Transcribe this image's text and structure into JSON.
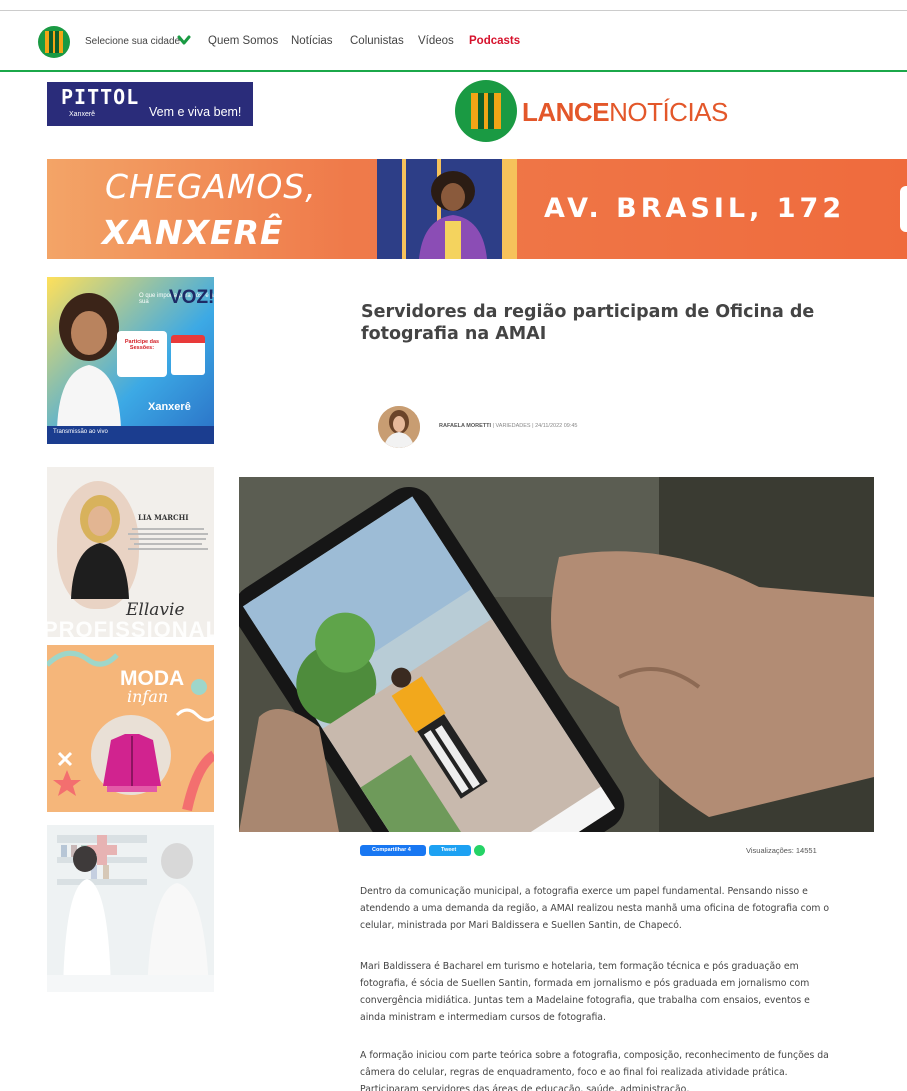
{
  "nav": {
    "city_select": "Selecione sua cidade",
    "links": [
      "Quem Somos",
      "Notícias",
      "Colunistas",
      "Vídeos",
      "Podcasts"
    ]
  },
  "header": {
    "pittol_brand": "PITTOL",
    "pittol_sub": "Xanxerê",
    "pittol_tagline": "Vem e viva bem!",
    "site_name_bold": "LANCE",
    "site_name_light": "NOTÍCIAS"
  },
  "banner": {
    "line1": "CHEGAMOS,",
    "line2": "XANXERÊ",
    "address": "AV. BRASIL, 172"
  },
  "sidebar_ads": {
    "ad1": {
      "question": "O que importa para nós, é a sua",
      "voz": "VOZ!",
      "participe": "Participe das Sessões:",
      "city": "Xanxerê",
      "transmission": "Transmissão ao vivo"
    },
    "ad2": {
      "name": "LIA MARCHI",
      "signature": "Ellavie",
      "watermark": "PROFISSIONAL"
    },
    "ad3": {
      "moda": "MODA",
      "infan": "infan"
    }
  },
  "article": {
    "title": "Servidores da região participam de Oficina de fotografia na AMAI",
    "author": "RAFAELA MORETTI",
    "byline_rest": " | VARIEDADES | 24/11/2022 09:45",
    "share_facebook": "Compartilhar",
    "share_tweet": "Tweet",
    "views": "Visualizações: 14551",
    "paragraphs": [
      "Dentro da comunicação municipal, a fotografia exerce um papel fundamental. Pensando nisso e atendendo a uma demanda da região, a AMAI realizou nesta manhã uma oficina de fotografia com o celular, ministrada por Mari Baldissera e Suellen Santin, de Chapecó.",
      "Mari Baldissera é Bacharel em turismo e hotelaria, tem formação técnica e pós graduação em fotografia, é sócia de Suellen Santin, formada em jornalismo e pós graduada em jornalismo com convergência midiática.  Juntas tem a Madelaine fotografia, que trabalha com ensaios, eventos e ainda ministram e intermediam cursos de fotografia.",
      "A formação iniciou com parte teórica sobre a fotografia, composição, reconhecimento de funções da câmera do celular, regras de enquadramento, foco e ao final foi realizada atividade prática. Participaram servidores das áreas de educação, saúde, administração,"
    ]
  },
  "colors": {
    "brand_green": "#1a9a43",
    "brand_orange": "#e3572a",
    "podcast_red": "#d6112b",
    "pittol_navy": "#2a2c7a"
  }
}
